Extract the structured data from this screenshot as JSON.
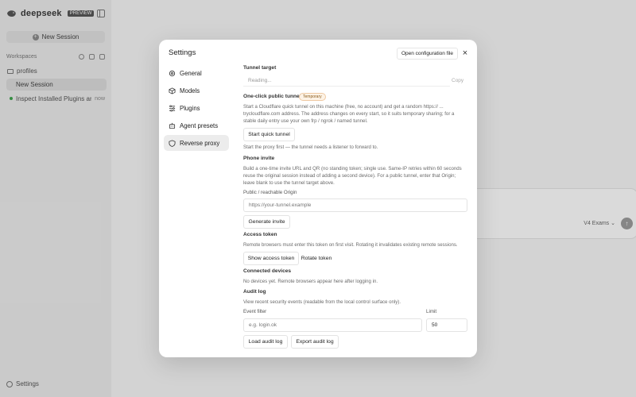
{
  "sidebar": {
    "brand": "deepseek",
    "brand_badge": "PREVIEW",
    "new_session": "New Session",
    "workspaces_label": "Workspaces",
    "profiles": "profiles",
    "session": "New Session",
    "plugin_item": "Inspect Installed Plugins an...",
    "plugin_more": "now",
    "settings": "Settings"
  },
  "composer": {
    "model": "V4 Exams",
    "send_icon": "arrow-up-icon"
  },
  "modal": {
    "title": "Settings",
    "open_config": "Open configuration file",
    "close": "×",
    "nav": [
      {
        "label": "General",
        "icon": "gear-icon"
      },
      {
        "label": "Models",
        "icon": "cube-icon"
      },
      {
        "label": "Plugins",
        "icon": "sliders-icon"
      },
      {
        "label": "Agent presets",
        "icon": "bot-icon"
      },
      {
        "label": "Reverse proxy",
        "icon": "shield-icon"
      }
    ],
    "active_nav": "Reverse proxy"
  },
  "proxy": {
    "tunnel_target": {
      "title": "Tunnel target",
      "value": "Reading...",
      "copy": "Copy"
    },
    "quick_tunnel": {
      "title": "One-click public tunnel",
      "badge": "Temporary",
      "help": "Start a Cloudflare quick tunnel on this machine (free, no account) and get a random https:// ... trycloudflare.com address. The address changes on every start, so it suits temporary sharing; for a stable daily entry use your own frp / ngrok / named tunnel.",
      "button": "Start quick tunnel",
      "note": "Start the proxy first — the tunnel needs a listener to forward to."
    },
    "phone_invite": {
      "title": "Phone invite",
      "help": "Build a one-time invite URL and QR (no standing token; single use. Same-IP retries within 60 seconds reuse the original session instead of adding a second device). For a public tunnel, enter that Origin; leave blank to use the tunnel target above.",
      "origin_label": "Public / reachable Origin",
      "origin_placeholder": "https://your-tunnel.example",
      "button": "Generate invite"
    },
    "access_token": {
      "title": "Access token",
      "help": "Remote browsers must enter this token on first visit. Rotating it invalidates existing remote sessions.",
      "show_button": "Show access token",
      "rotate_button": "Rotate token"
    },
    "connected_devices": {
      "title": "Connected devices",
      "help": "No devices yet. Remote browsers appear here after logging in."
    },
    "audit_log": {
      "title": "Audit log",
      "help": "View recent security events (readable from the local control surface only).",
      "filter_label": "Event filter",
      "filter_placeholder": "e.g. login.ok",
      "limit_label": "Limit",
      "limit_value": "50",
      "load_button": "Load audit log",
      "export_button": "Export audit log"
    }
  }
}
